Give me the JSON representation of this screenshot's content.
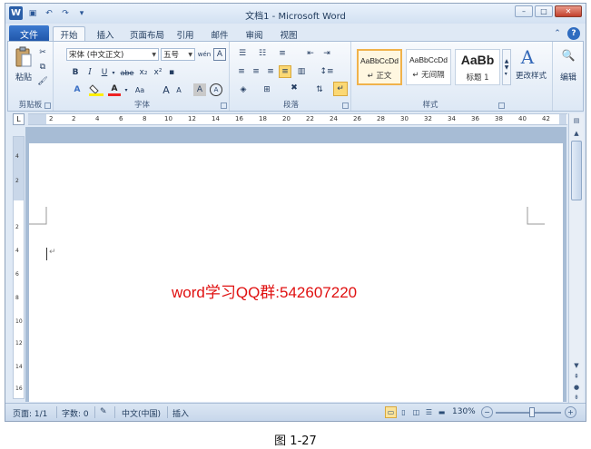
{
  "window": {
    "title": "文档1 - Microsoft Word",
    "logo": "W",
    "min": "–",
    "max": "□",
    "close": "✕"
  },
  "qat": {
    "save_icon": "💾",
    "undo_icon": "↶",
    "redo_icon": "↷",
    "custom_icon": "▾"
  },
  "tabs": {
    "file": "文件",
    "items": [
      {
        "label": "开始",
        "active": true
      },
      {
        "label": "插入"
      },
      {
        "label": "页面布局"
      },
      {
        "label": "引用"
      },
      {
        "label": "邮件"
      },
      {
        "label": "审阅"
      },
      {
        "label": "视图"
      }
    ]
  },
  "ribbon": {
    "clipboard": {
      "label": "剪贴板",
      "paste": "粘贴"
    },
    "font": {
      "label": "字体",
      "font_name": "宋体 (中文正文)",
      "font_size": "五号",
      "bold": "B",
      "italic": "I",
      "underline": "U",
      "strike": "abe",
      "subscript": "x₂",
      "superscript": "x²",
      "grow": "A",
      "shrink": "A",
      "case": "Aa",
      "clear": "A",
      "phonetic": "wén",
      "enclose": "A"
    },
    "paragraph": {
      "label": "段落"
    },
    "styles": {
      "label": "样式",
      "items": [
        {
          "sample": "AaBbCcDd",
          "name": "↵ 正文",
          "selected": true
        },
        {
          "sample": "AaBbCcDd",
          "name": "↵ 无间隔"
        },
        {
          "sample": "AaBb",
          "name": "标题 1"
        }
      ],
      "change_styles": "更改样式"
    },
    "editing": {
      "label": "编辑"
    }
  },
  "ruler": {
    "h_ticks": [
      "2",
      "2",
      "4",
      "6",
      "8",
      "10",
      "12",
      "14",
      "16",
      "18",
      "20",
      "22",
      "24",
      "26",
      "28",
      "30",
      "32",
      "34",
      "36",
      "38",
      "40",
      "42"
    ],
    "v_ticks": [
      "4",
      "2",
      "2",
      "4",
      "6",
      "8",
      "10",
      "12",
      "14",
      "16"
    ]
  },
  "document": {
    "text": "word学习QQ群:542607220",
    "paragraph_mark": "↵"
  },
  "status": {
    "page": "页面: 1/1",
    "words": "字数: 0",
    "language": "中文(中国)",
    "mode": "插入",
    "zoom": "130%",
    "zoom_minus": "−",
    "zoom_plus": "+",
    "zoom_level_fraction": 0.55
  },
  "caption": "图 1-27"
}
